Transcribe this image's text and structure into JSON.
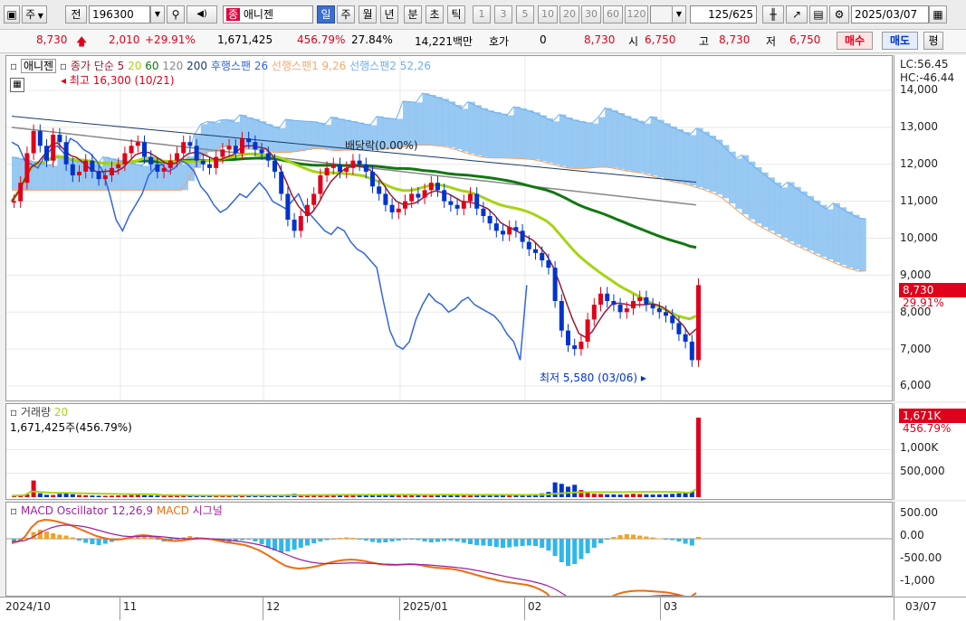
{
  "toolbar": {
    "market_label": "주",
    "scope_label": "전",
    "code": "196300",
    "stock_name": "애니젠",
    "stock_type_badge": "종",
    "periods": [
      "일",
      "주",
      "월",
      "년",
      "분",
      "초",
      "틱"
    ],
    "active_period": "일",
    "intervals": [
      "1",
      "3",
      "5",
      "10",
      "20",
      "30",
      "60",
      "120"
    ],
    "view_count": "125",
    "view_total": "/625",
    "date": "2025/03/07"
  },
  "quote": {
    "price": "8,730",
    "change": "2,010",
    "change_pct": "+29.91%",
    "volume": "1,671,425",
    "volume_ratio": "456.79%",
    "turnover": "27.84%",
    "amount": "14,221백만",
    "hoga_label": "호가",
    "hoga_value": "0",
    "ask": "8,730",
    "open_label": "시",
    "open": "6,750",
    "high_label": "고",
    "high": "8,730",
    "low_label": "저",
    "low": "6,750",
    "buy_label": "매수",
    "sell_label": "매도",
    "eval_label": "평"
  },
  "legend": {
    "name": "애니젠",
    "close_simple": "종가 단순 5",
    "ma20": "20",
    "ma60": "60",
    "ma120": "120",
    "ma200": "200",
    "lagging": "후행스팬 26",
    "lead1": "선행스팬1 9,26",
    "lead2": "선행스팬2 52,26",
    "lc": "LC:56.45",
    "hc": "HC:-46.44"
  },
  "annotations": {
    "high": "최고 16,300 (10/21)",
    "low": "최저 5,580 (03/06)",
    "dividend": "배당락(0.00%)"
  },
  "price_axis": [
    "14,000",
    "13,000",
    "12,000",
    "11,000",
    "10,000",
    "9,000",
    "8,000",
    "7,000",
    "6,000"
  ],
  "price_tag": {
    "price": "8,730",
    "pct": "29.91%"
  },
  "volume_legend": {
    "label": "거래량",
    "ma": "20",
    "value": "1,671,425주(456.79%)"
  },
  "volume_axis": [
    "1,000K",
    "500,000"
  ],
  "volume_tag": {
    "value": "1,671K",
    "pct": "456.79%"
  },
  "macd_legend": {
    "osc": "MACD Oscillator 12,26,9",
    "macd": "MACD",
    "signal": "시그널"
  },
  "macd_axis": [
    "500.00",
    "0.00",
    "-500.00",
    "-1,000"
  ],
  "x_labels": [
    "2024/10",
    "11",
    "12",
    "2025/01",
    "02",
    "03"
  ],
  "x_right_label": "03/07",
  "colors": {
    "up": "#e0001b",
    "down": "#0033cc",
    "ma5": "#9b1b30",
    "ma20": "#a6d411",
    "ma60": "#117711",
    "ma120": "#888888",
    "ma200": "#1a3a6b",
    "lagging": "#3366dd",
    "cloud_up": "#f8b98a",
    "cloud_down": "#8dc3f2",
    "macd": "#ee6d10",
    "signal": "#a020a0"
  },
  "chart_data": {
    "type": "candlestick",
    "ylim": [
      5580,
      16300
    ],
    "x_range": [
      "2024/10",
      "03/07"
    ],
    "last_close": 8730,
    "high_point": {
      "value": 16300,
      "date": "10/21"
    },
    "low_point": {
      "value": 5580,
      "date": "03/06"
    },
    "closes": [
      11000,
      11500,
      12300,
      12900,
      12500,
      12100,
      12800,
      12600,
      12000,
      11700,
      11800,
      12100,
      11800,
      11600,
      11700,
      11900,
      12000,
      12300,
      12500,
      12600,
      12200,
      12000,
      11800,
      11900,
      12100,
      12300,
      12600,
      12500,
      12100,
      12000,
      11900,
      12200,
      12400,
      12500,
      12300,
      12700,
      12600,
      12400,
      12300,
      12100,
      11800,
      11200,
      10500,
      10200,
      10600,
      10900,
      11200,
      11700,
      11900,
      12000,
      11800,
      11900,
      12100,
      12000,
      11800,
      11400,
      11200,
      10900,
      10700,
      10800,
      11000,
      11200,
      11100,
      11300,
      11500,
      11300,
      11000,
      10900,
      10800,
      11000,
      11200,
      10800,
      10600,
      10400,
      10200,
      10100,
      10300,
      10200,
      9900,
      9700,
      9600,
      9400,
      9200,
      8300,
      7500,
      7100,
      7000,
      7200,
      7800,
      8200,
      8500,
      8300,
      8200,
      8000,
      8100,
      8300,
      8400,
      8200,
      8100,
      8000,
      7900,
      7700,
      7400,
      7200,
      6700,
      8730
    ],
    "volume_k": [
      30,
      40,
      60,
      350,
      80,
      50,
      45,
      70,
      90,
      60,
      45,
      40,
      35,
      30,
      28,
      30,
      34,
      38,
      45,
      50,
      40,
      36,
      32,
      28,
      30,
      33,
      40,
      46,
      38,
      34,
      30,
      33,
      38,
      42,
      36,
      40,
      44,
      50,
      45,
      40,
      38,
      50,
      60,
      70,
      55,
      48,
      45,
      52,
      58,
      60,
      55,
      50,
      48,
      45,
      43,
      50,
      55,
      60,
      58,
      52,
      48,
      45,
      43,
      46,
      50,
      48,
      55,
      60,
      58,
      52,
      50,
      48,
      46,
      44,
      42,
      40,
      45,
      50,
      48,
      45,
      60,
      80,
      110,
      310,
      280,
      220,
      260,
      150,
      90,
      70,
      65,
      60,
      58,
      55,
      60,
      70,
      65,
      60,
      55,
      58,
      62,
      70,
      80,
      90,
      120,
      1671
    ],
    "macd_osc": [
      -80,
      -60,
      20,
      150,
      200,
      160,
      120,
      90,
      70,
      30,
      -40,
      -90,
      -120,
      -140,
      -110,
      -70,
      -30,
      10,
      60,
      90,
      80,
      40,
      -20,
      -60,
      -40,
      -10,
      30,
      60,
      40,
      20,
      -10,
      -40,
      -60,
      -70,
      -50,
      -30,
      -20,
      -60,
      -120,
      -200,
      -260,
      -300,
      -280,
      -240,
      -200,
      -150,
      -100,
      -60,
      -30,
      0,
      20,
      30,
      20,
      -10,
      -40,
      -70,
      -90,
      -80,
      -60,
      -40,
      -20,
      -10,
      -30,
      -60,
      -80,
      -70,
      -50,
      -40,
      -60,
      -90,
      -120,
      -140,
      -150,
      -160,
      -180,
      -200,
      -190,
      -170,
      -160,
      -150,
      -160,
      -200,
      -260,
      -380,
      -520,
      -600,
      -560,
      -450,
      -320,
      -200,
      -100,
      -20,
      40,
      80,
      100,
      90,
      70,
      50,
      30,
      10,
      -10,
      -30,
      -60,
      -110,
      -150,
      40
    ],
    "macd": [
      -100,
      -60,
      40,
      250,
      380,
      420,
      410,
      380,
      340,
      300,
      240,
      180,
      120,
      60,
      20,
      -10,
      -20,
      -10,
      20,
      60,
      80,
      70,
      40,
      0,
      -40,
      -50,
      -40,
      -20,
      0,
      10,
      0,
      -20,
      -50,
      -80,
      -100,
      -120,
      -150,
      -200,
      -260,
      -340,
      -430,
      -520,
      -600,
      -640,
      -660,
      -650,
      -630,
      -600,
      -560,
      -520,
      -490,
      -470,
      -460,
      -470,
      -490,
      -520,
      -550,
      -570,
      -580,
      -580,
      -570,
      -560,
      -570,
      -590,
      -620,
      -640,
      -650,
      -660,
      -680,
      -710,
      -750,
      -790,
      -830,
      -870,
      -900,
      -940,
      -960,
      -980,
      -1000,
      -1020,
      -1060,
      -1120,
      -1200,
      -1350,
      -1520,
      -1640,
      -1680,
      -1660,
      -1600,
      -1520,
      -1430,
      -1350,
      -1280,
      -1220,
      -1180,
      -1160,
      -1150,
      -1150,
      -1160,
      -1170,
      -1180,
      -1200,
      -1230,
      -1270,
      -1300,
      -1200
    ],
    "signal": [
      -60,
      -60,
      -40,
      20,
      100,
      180,
      240,
      280,
      300,
      300,
      290,
      270,
      240,
      200,
      160,
      120,
      90,
      60,
      50,
      50,
      55,
      58,
      55,
      45,
      30,
      15,
      5,
      0,
      0,
      0,
      0,
      -5,
      -15,
      -30,
      -45,
      -60,
      -80,
      -105,
      -135,
      -175,
      -225,
      -280,
      -340,
      -400,
      -450,
      -490,
      -520,
      -540,
      -550,
      -550,
      -545,
      -540,
      -535,
      -535,
      -540,
      -545,
      -550,
      -560,
      -565,
      -570,
      -570,
      -568,
      -568,
      -572,
      -580,
      -592,
      -605,
      -618,
      -632,
      -648,
      -668,
      -692,
      -720,
      -750,
      -780,
      -812,
      -842,
      -870,
      -895,
      -920,
      -950,
      -985,
      -1030,
      -1090,
      -1170,
      -1260,
      -1340,
      -1400,
      -1440,
      -1460,
      -1460,
      -1450,
      -1430,
      -1400,
      -1370,
      -1340,
      -1310,
      -1290,
      -1270,
      -1260,
      -1255,
      -1255,
      -1260,
      -1270,
      -1280,
      -1270
    ]
  }
}
